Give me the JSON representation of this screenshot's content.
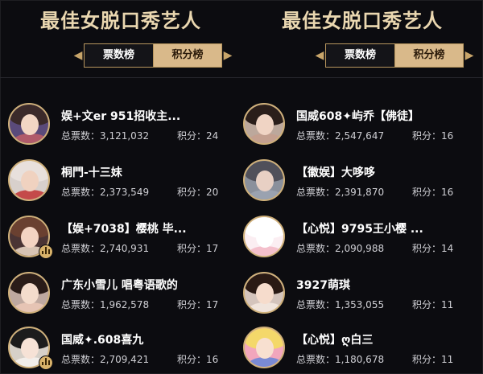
{
  "left": {
    "title": "最佳女脱口秀艺人",
    "tabs": {
      "votes": "票数榜",
      "points": "积分榜"
    },
    "rows": [
      {
        "name": "娱+文er 951招收主...",
        "votes_label": "总票数：",
        "votes": "3,121,032",
        "points_label": "积分：",
        "points": "24",
        "badge": false
      },
      {
        "name": "桐門-十三妹",
        "votes_label": "总票数：",
        "votes": "2,373,549",
        "points_label": "积分：",
        "points": "20",
        "badge": false
      },
      {
        "name": "【娱+7038】樱桃 毕...",
        "votes_label": "总票数：",
        "votes": "2,740,931",
        "points_label": "积分：",
        "points": "17",
        "badge": true
      },
      {
        "name": "广东小雪儿 唱粤语歌的",
        "votes_label": "总票数：",
        "votes": "1,962,578",
        "points_label": "积分：",
        "points": "17",
        "badge": false
      },
      {
        "name": "国威✦.608喜九",
        "votes_label": "总票数：",
        "votes": "2,709,421",
        "points_label": "积分：",
        "points": "16",
        "badge": true
      }
    ]
  },
  "right": {
    "title": "最佳女脱口秀艺人",
    "tabs": {
      "votes": "票数榜",
      "points": "积分榜"
    },
    "rows": [
      {
        "name": "国威608✦屿乔【佛徒】",
        "votes_label": "总票数：",
        "votes": "2,547,647",
        "points_label": "积分：",
        "points": "16",
        "badge": false
      },
      {
        "name": "【徽娱】大哆哆",
        "votes_label": "总票数：",
        "votes": "2,391,870",
        "points_label": "积分：",
        "points": "16",
        "badge": false
      },
      {
        "name": "【心悦】9795王小樱 ...",
        "votes_label": "总票数：",
        "votes": "2,090,988",
        "points_label": "积分：",
        "points": "14",
        "badge": false
      },
      {
        "name": "3927萌琪",
        "votes_label": "总票数：",
        "votes": "1,353,055",
        "points_label": "积分：",
        "points": "11",
        "badge": false
      },
      {
        "name": "【心悦】ღ白三",
        "votes_label": "总票数：",
        "votes": "1,180,678",
        "points_label": "积分：",
        "points": "11",
        "badge": false
      }
    ]
  },
  "colors": {
    "accent_gold": "#cfb07a",
    "active_tab": "#d9b98a",
    "background": "#0c0c10"
  },
  "icons": {
    "tab_arrow_left": "chevron-left-icon",
    "tab_arrow_right": "chevron-right-icon",
    "badge": "bar-chart-icon"
  }
}
